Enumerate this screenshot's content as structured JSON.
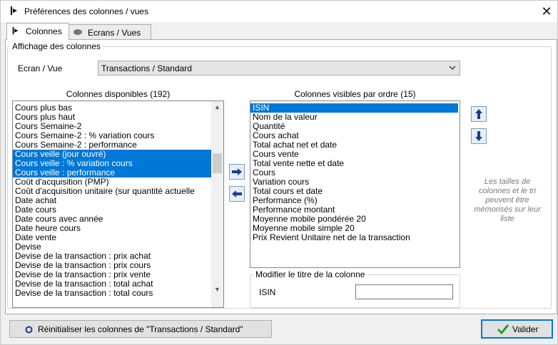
{
  "window": {
    "title": "Préférences des colonnes / vues",
    "close_label": "✕"
  },
  "tabs": [
    {
      "label": "Colonnes",
      "active": true
    },
    {
      "label": "Ecrans / Vues",
      "active": false
    }
  ],
  "display_group": {
    "legend": "Affichage des colonnes",
    "screen_label": "Ecran / Vue",
    "screen_value": "Transactions / Standard"
  },
  "available": {
    "header": "Colonnes disponibles (192)",
    "items": [
      {
        "label": "Cours plus bas",
        "selected": false
      },
      {
        "label": "Cours plus haut",
        "selected": false
      },
      {
        "label": "Cours Semaine-2",
        "selected": false
      },
      {
        "label": "Cours Semaine-2 : % variation cours",
        "selected": false
      },
      {
        "label": "Cours Semaine-2 : performance",
        "selected": false
      },
      {
        "label": "Cours veille (jour ouvré)",
        "selected": true
      },
      {
        "label": "Cours veille : % variation cours",
        "selected": true
      },
      {
        "label": "Cours veille : performance",
        "selected": true
      },
      {
        "label": "Coût d'acquisition (PMP)",
        "selected": false
      },
      {
        "label": "Coût d'acquisition unitaire (sur quantité actuelle",
        "selected": false
      },
      {
        "label": "Date achat",
        "selected": false
      },
      {
        "label": "Date cours",
        "selected": false
      },
      {
        "label": "Date cours avec année",
        "selected": false
      },
      {
        "label": "Date heure cours",
        "selected": false
      },
      {
        "label": "Date vente",
        "selected": false
      },
      {
        "label": "Devise",
        "selected": false
      },
      {
        "label": "Devise de la transaction : prix achat",
        "selected": false
      },
      {
        "label": "Devise de la transaction : prix cours",
        "selected": false
      },
      {
        "label": "Devise de la transaction : prix vente",
        "selected": false
      },
      {
        "label": "Devise de la transaction : total achat",
        "selected": false
      },
      {
        "label": "Devise de la transaction : total cours",
        "selected": false
      }
    ]
  },
  "visible": {
    "header": "Colonnes visibles par ordre (15)",
    "items": [
      {
        "label": "ISIN",
        "selected": true
      },
      {
        "label": "Nom de la valeur",
        "selected": false
      },
      {
        "label": "Quantité",
        "selected": false
      },
      {
        "label": "Cours achat",
        "selected": false
      },
      {
        "label": "Total achat net et date",
        "selected": false
      },
      {
        "label": "Cours vente",
        "selected": false
      },
      {
        "label": "Total vente nette et date",
        "selected": false
      },
      {
        "label": "Cours",
        "selected": false
      },
      {
        "label": "Variation cours",
        "selected": false
      },
      {
        "label": "Total cours et date",
        "selected": false
      },
      {
        "label": "Performance (%)",
        "selected": false
      },
      {
        "label": "Performance montant",
        "selected": false
      },
      {
        "label": "Moyenne mobile pondérée 20",
        "selected": false
      },
      {
        "label": "Moyenne mobile simple 20",
        "selected": false
      },
      {
        "label": "Prix Revient Unitaire net de la transaction",
        "selected": false
      }
    ]
  },
  "hint": "Les tailles de colonnes et le tri peuvent être mémorisés sur leur liste",
  "rename_group": {
    "legend": "Modifier le titre de la colonne",
    "field_label": "ISIN",
    "field_value": ""
  },
  "buttons": {
    "reset": "Réinitialiser les colonnes de \"Transactions / Standard\"",
    "validate": "Valider"
  },
  "colors": {
    "selection": "#0078d7",
    "arrow_blue": "#1a3e8c",
    "check_green": "#2e9a2e"
  }
}
